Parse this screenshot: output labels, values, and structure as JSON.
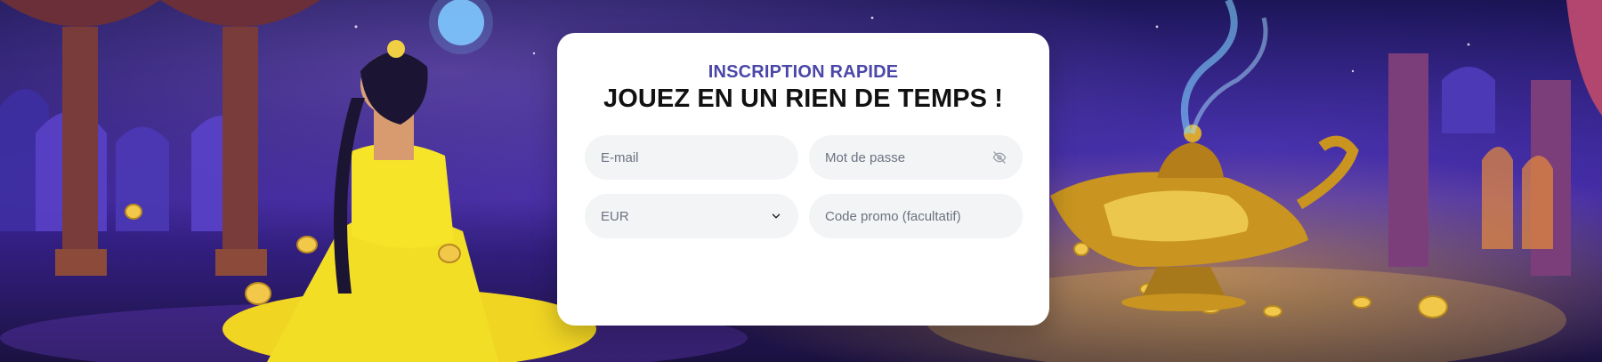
{
  "signup": {
    "kicker": "INSCRIPTION RAPIDE",
    "headline": "JOUEZ EN UN RIEN DE TEMPS !",
    "email_placeholder": "E-mail",
    "password_placeholder": "Mot de passe",
    "currency_value": "EUR",
    "promo_placeholder": "Code promo (facultatif)"
  },
  "icons": {
    "password_toggle": "eye-slash-icon",
    "currency_dropdown": "chevron-down-icon"
  },
  "colors": {
    "kicker": "#4b47a8",
    "headline": "#111111",
    "field_bg": "#f3f4f6",
    "card_bg": "#ffffff"
  }
}
